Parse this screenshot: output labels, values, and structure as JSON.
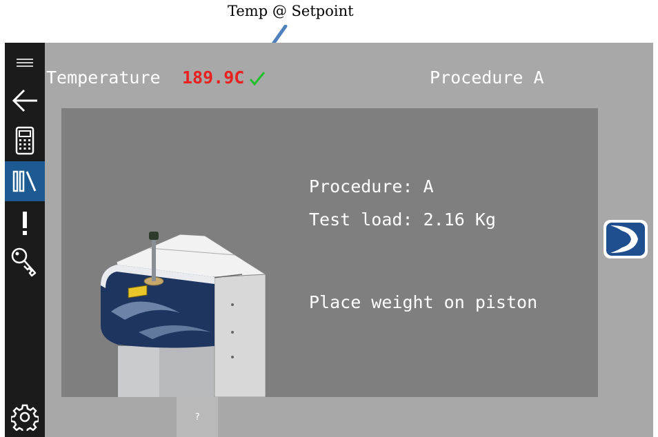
{
  "annotation": {
    "text": "Temp @ Setpoint"
  },
  "sidebar": {
    "items": [
      {
        "icon": "hamburger-menu-icon",
        "active": false
      },
      {
        "icon": "back-arrow-icon",
        "active": false
      },
      {
        "icon": "calculator-icon",
        "active": false
      },
      {
        "icon": "library-icon",
        "active": true
      },
      {
        "icon": "alert-icon",
        "active": false
      },
      {
        "icon": "key-icon",
        "active": false
      },
      {
        "icon": "gear-icon",
        "active": false
      }
    ]
  },
  "header": {
    "temperature_label": "Temperature",
    "temperature_value": "189.9C",
    "status_icon": "check-icon",
    "procedure_title": "Procedure A"
  },
  "panel": {
    "procedure_line": "Procedure: A",
    "load_line": "Test load: 2.16 Kg",
    "instruction": "Place weight on piston"
  },
  "footer": {
    "help_label": "?"
  },
  "colors": {
    "temperature": "#e8201f",
    "check": "#22c02a",
    "active_nav": "#1c5a91",
    "sidebar_bg": "#1b1b1b",
    "screen_bg": "#a8a8a8",
    "panel_bg": "#7f7f7f"
  }
}
